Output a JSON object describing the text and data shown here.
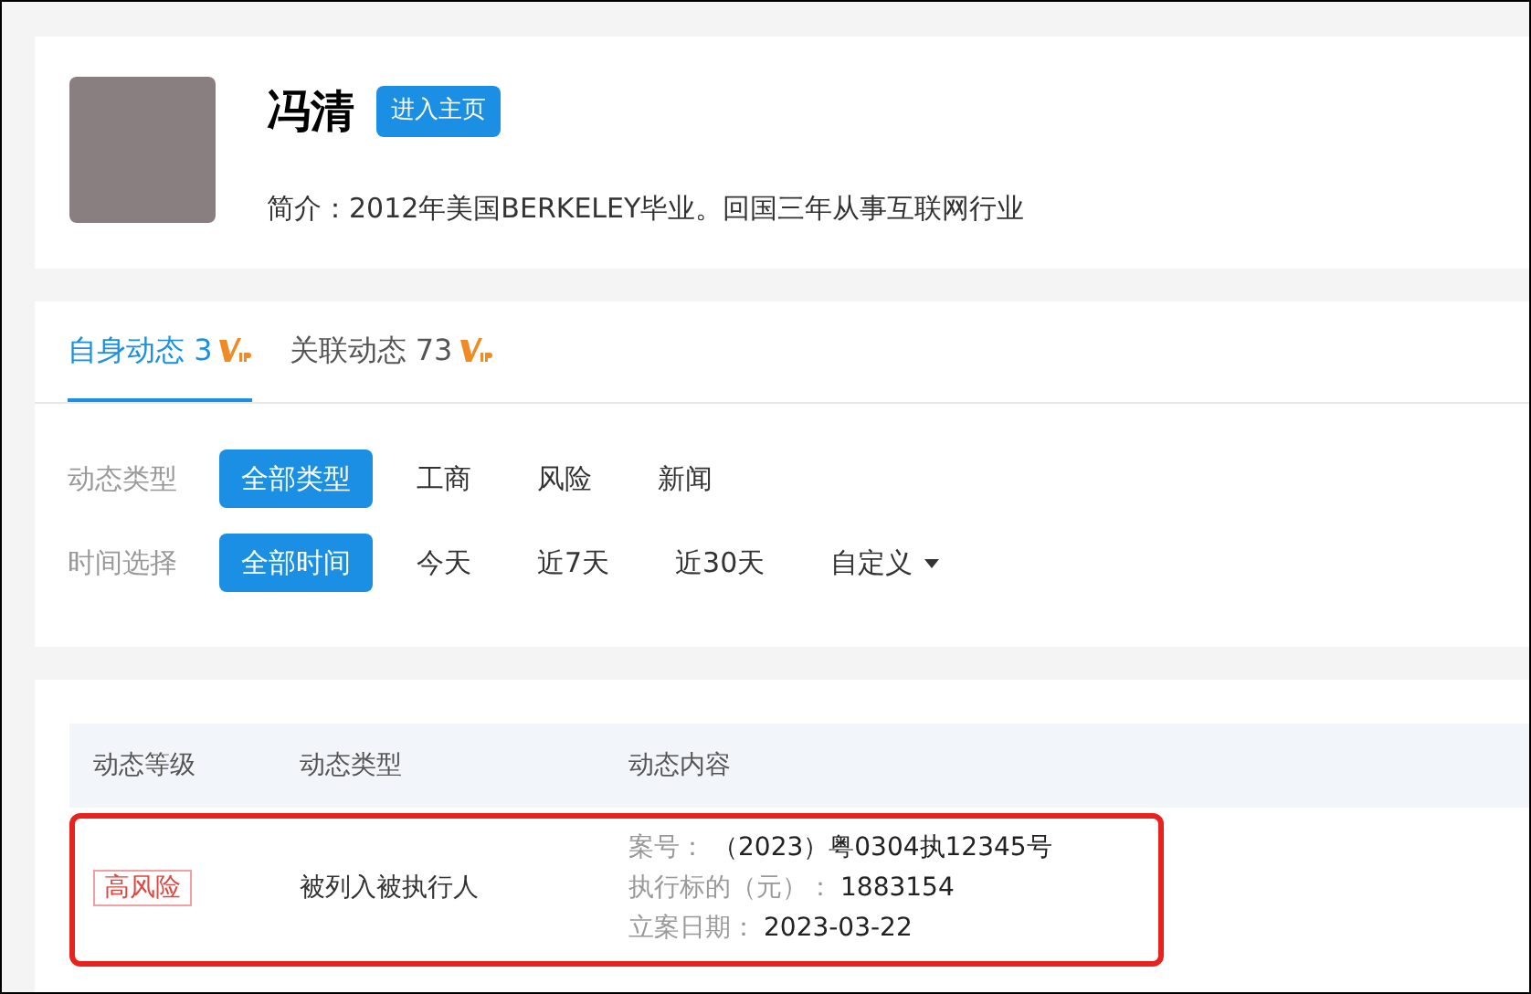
{
  "profile": {
    "name": "冯清",
    "home_button": "进入主页",
    "bio": "简介：2012年美国BERKELEY毕业。回国三年从事互联网行业"
  },
  "tabs": [
    {
      "label": "自身动态 3",
      "vip": true,
      "selected": true
    },
    {
      "label": "关联动态 73",
      "vip": true,
      "selected": false
    }
  ],
  "filters": [
    {
      "label": "动态类型",
      "options": [
        {
          "label": "全部类型",
          "selected": true,
          "dropdown": false
        },
        {
          "label": "工商",
          "selected": false,
          "dropdown": false
        },
        {
          "label": "风险",
          "selected": false,
          "dropdown": false
        },
        {
          "label": "新闻",
          "selected": false,
          "dropdown": false
        }
      ]
    },
    {
      "label": "时间选择",
      "options": [
        {
          "label": "全部时间",
          "selected": true,
          "dropdown": false
        },
        {
          "label": "今天",
          "selected": false,
          "dropdown": false
        },
        {
          "label": "近7天",
          "selected": false,
          "dropdown": false
        },
        {
          "label": "近30天",
          "selected": false,
          "dropdown": false
        },
        {
          "label": "自定义",
          "selected": false,
          "dropdown": true
        }
      ]
    }
  ],
  "table": {
    "columns": [
      "动态等级",
      "动态类型",
      "动态内容"
    ],
    "rows": [
      {
        "level": "高风险",
        "type": "被列入被执行人",
        "highlighted": true,
        "content": [
          {
            "label": "案号：",
            "value": "（2023）粤0304执12345号"
          },
          {
            "label": "执行标的（元）：",
            "value": "1883154"
          },
          {
            "label": "立案日期：",
            "value": "2023-03-22"
          }
        ]
      }
    ]
  }
}
